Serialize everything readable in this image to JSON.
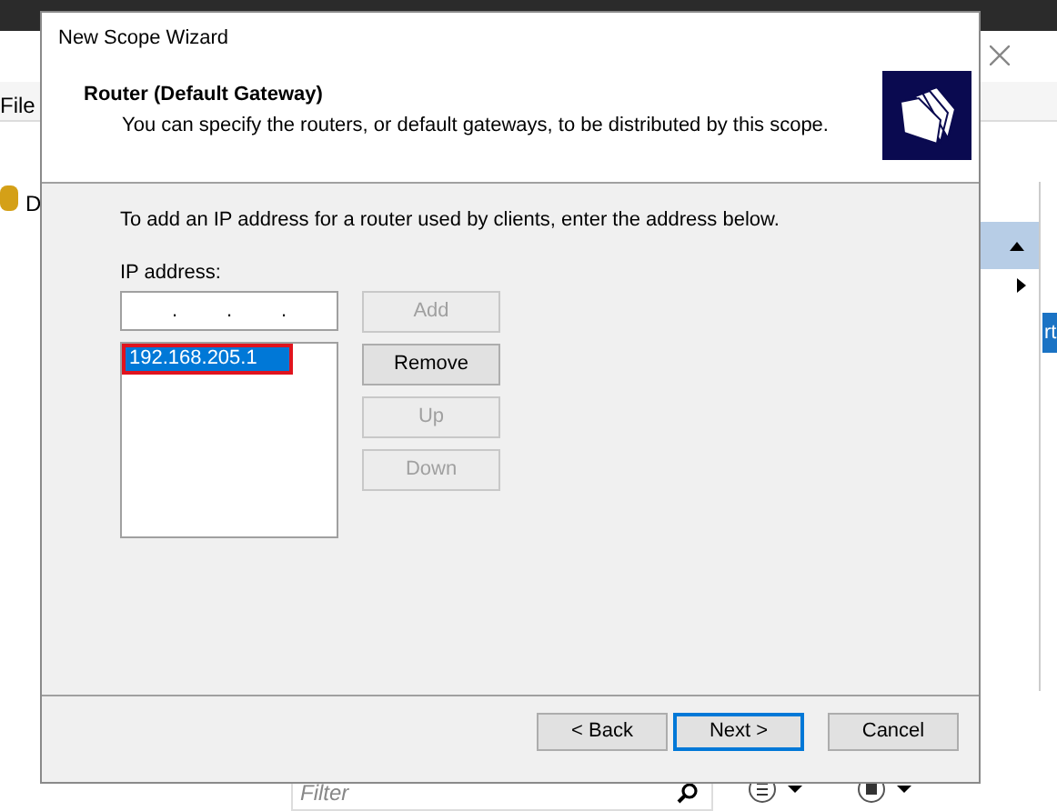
{
  "background": {
    "menu_label": "File",
    "tree_label": "D",
    "side_tab": "rt",
    "filter": {
      "placeholder": "Filter"
    }
  },
  "dialog": {
    "title": "New Scope Wizard",
    "heading": "Router (Default Gateway)",
    "subtitle": "You can specify the routers, or default gateways, to be distributed by this scope.",
    "instruction": "To add an IP address for a router used by clients, enter the address below.",
    "ip_label": "IP address:",
    "ip_field": {
      "dots": [
        ".",
        ".",
        "."
      ]
    },
    "routers": [
      {
        "address": "192.168.205.1",
        "selected": true,
        "highlighted": true
      }
    ],
    "side_buttons": [
      {
        "label": "Add",
        "disabled": true
      },
      {
        "label": "Remove",
        "disabled": false
      },
      {
        "label": "Up",
        "disabled": true
      },
      {
        "label": "Down",
        "disabled": true
      }
    ],
    "footer_buttons": [
      {
        "label": "< Back",
        "default": false
      },
      {
        "label": "Next >",
        "default": true
      },
      {
        "label": "Cancel",
        "default": false
      }
    ]
  }
}
